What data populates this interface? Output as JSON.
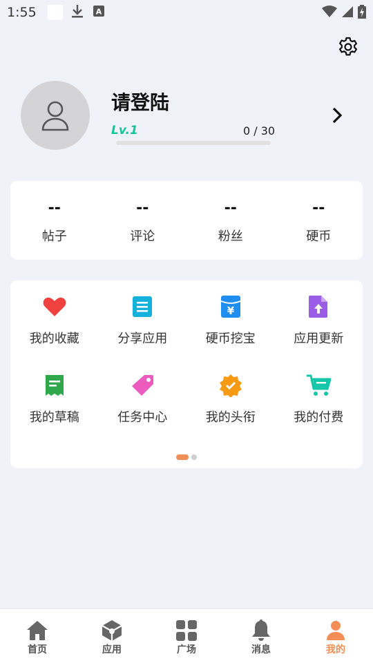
{
  "status_bar": {
    "time": "1:55"
  },
  "profile": {
    "username": "请登陆",
    "level": "Lv.1",
    "progress_text": "0 / 30",
    "progress_fraction": 0
  },
  "stats": [
    {
      "value": "--",
      "label": "帖子"
    },
    {
      "value": "--",
      "label": "评论"
    },
    {
      "value": "--",
      "label": "粉丝"
    },
    {
      "value": "--",
      "label": "硬币"
    }
  ],
  "menu": [
    {
      "label": "我的收藏",
      "icon": "heart-icon",
      "color": "#f0413e"
    },
    {
      "label": "分享应用",
      "icon": "list-icon",
      "color": "#14b1dd"
    },
    {
      "label": "硬币挖宝",
      "icon": "yuan-box-icon",
      "color": "#1e8ef0"
    },
    {
      "label": "应用更新",
      "icon": "upload-file-icon",
      "color": "#9b5de5"
    },
    {
      "label": "我的草稿",
      "icon": "draft-icon",
      "color": "#2ea84a"
    },
    {
      "label": "任务中心",
      "icon": "tag-icon",
      "color": "#ee5bbf"
    },
    {
      "label": "我的头衔",
      "icon": "badge-icon",
      "color": "#f59a12"
    },
    {
      "label": "我的付费",
      "icon": "cart-icon",
      "color": "#15c6a8"
    }
  ],
  "tabs": [
    {
      "label": "首页",
      "icon": "home-icon"
    },
    {
      "label": "应用",
      "icon": "box-icon"
    },
    {
      "label": "广场",
      "icon": "grid-icon"
    },
    {
      "label": "消息",
      "icon": "bell-icon"
    },
    {
      "label": "我的",
      "icon": "person-icon",
      "active": true
    }
  ],
  "colors": {
    "accent": "#f58d56",
    "level": "#17c39a",
    "background": "#eff2f8"
  }
}
